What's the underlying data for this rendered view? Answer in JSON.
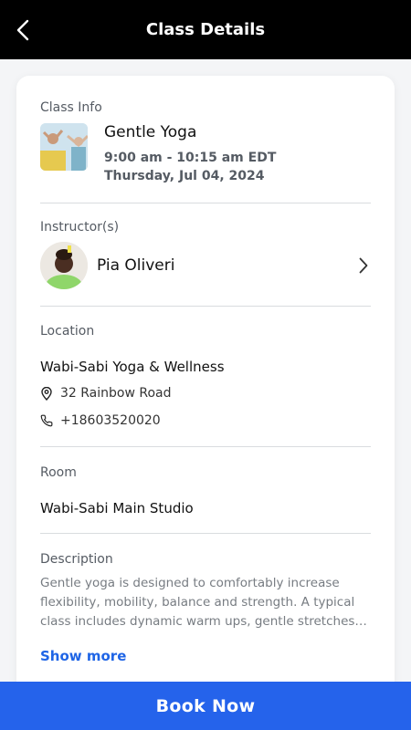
{
  "header": {
    "title": "Class Details",
    "back_icon": "chevron-left-icon"
  },
  "class_info": {
    "label": "Class Info",
    "name": "Gentle Yoga",
    "time": "9:00 am - 10:15 am EDT",
    "date": "Thursday, Jul 04, 2024"
  },
  "instructor": {
    "label": "Instructor(s)",
    "name": "Pia Oliveri"
  },
  "location": {
    "label": "Location",
    "name": "Wabi-Sabi Yoga & Wellness",
    "address": "32 Rainbow Road",
    "phone": "+18603520020"
  },
  "room": {
    "label": "Room",
    "name": "Wabi-Sabi Main Studio"
  },
  "description": {
    "label": "Description",
    "text": "Gentle yoga is designed to comfortably increase flexibility, mobility, balance and strength. A typical class includes dynamic warm ups, gentle stretches, breathing and relaxation.",
    "show_more": "Show more"
  },
  "book_button": "Book Now",
  "colors": {
    "header_bg": "#000000",
    "accent": "#2563eb",
    "link": "#1f65e6"
  }
}
